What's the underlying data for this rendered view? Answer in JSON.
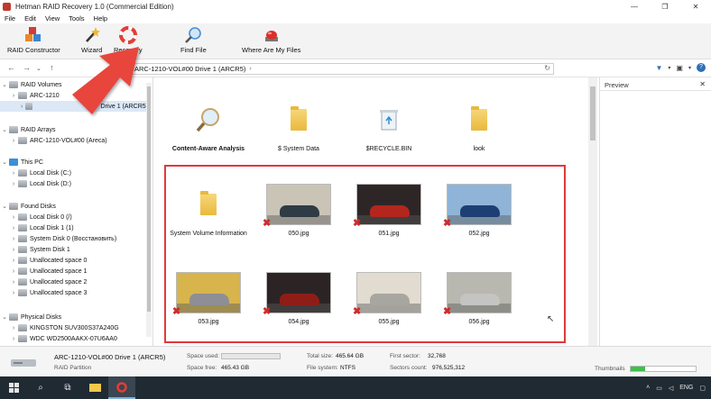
{
  "window": {
    "title": "Hetman RAID Recovery 1.0 (Commercial Edition)",
    "minimize": "—",
    "maximize": "❐",
    "close": "✕"
  },
  "menu": [
    "File",
    "Edit",
    "View",
    "Tools",
    "Help"
  ],
  "ribbon": {
    "raid_constructor": "RAID Constructor",
    "wizard": "Wizard",
    "recovery": "Recovery",
    "find_file": "Find File",
    "where_are_my_files": "Where Are My Files"
  },
  "address": {
    "path": "ARC-1210-VOL#00 Drive 1 (ARCR5)",
    "chevron": "›",
    "refresh": "↻"
  },
  "tree": {
    "raid_volumes": "RAID Volumes",
    "rv_item1": "ARC-1210",
    "rv_item2": "Drive 1 (ARCR5)",
    "raid_arrays": "RAID Arrays",
    "ra_item1": "ARC-1210-VOL#00 (Areca)",
    "this_pc": "This PC",
    "local_c": "Local Disk (C:)",
    "local_d": "Local Disk (D:)",
    "found_disks": "Found Disks",
    "fd_local0": "Local Disk 0 (/)",
    "fd_local1": "Local Disk 1 (1)",
    "fd_sys0": "System Disk 0 (Восстановить)",
    "fd_sys1": "System Disk 1",
    "fd_un0": "Unallocated space 0",
    "fd_un1": "Unallocated space 1",
    "fd_un2": "Unallocated space 2",
    "fd_un3": "Unallocated space 3",
    "physical_disks": "Physical Disks",
    "pd_kingston": "KINGSTON SUV300S37A240G",
    "pd_wdc": "WDC WD2500AAKX-07U6AA0"
  },
  "files": {
    "top": [
      {
        "name": "Content-Aware Analysis",
        "kind": "magnifier"
      },
      {
        "name": "$ System Data",
        "kind": "folder"
      },
      {
        "name": "$RECYCLE.BIN",
        "kind": "recycle"
      },
      {
        "name": "look",
        "kind": "folder"
      }
    ],
    "row1": [
      {
        "name": "System Volume Information",
        "kind": "folder"
      },
      {
        "name": "050.jpg",
        "kind": "photo",
        "sky": "#c9c4b6",
        "car": "#2f3b45"
      },
      {
        "name": "051.jpg",
        "kind": "photo",
        "sky": "#2e2626",
        "car": "#b3261e"
      },
      {
        "name": "052.jpg",
        "kind": "photo",
        "sky": "#8fb4d8",
        "car": "#1d3f73"
      }
    ],
    "row2": [
      {
        "name": "053.jpg",
        "kind": "photo",
        "sky": "#d8b44c",
        "car": "#8d8f94"
      },
      {
        "name": "054.jpg",
        "kind": "photo",
        "sky": "#2c2424",
        "car": "#8e1d18"
      },
      {
        "name": "055.jpg",
        "kind": "photo",
        "sky": "#e2dcd0",
        "car": "#a8a6a0"
      },
      {
        "name": "056.jpg",
        "kind": "photo",
        "sky": "#b8b8b0",
        "car": "#c4c4c2"
      }
    ]
  },
  "preview": {
    "title": "Preview",
    "close": "✕"
  },
  "status": {
    "name": "ARC-1210-VOL#00 Drive 1 (ARCR5)",
    "type": "RAID Partition",
    "space_used_label": "Space used:",
    "space_free_label": "Space free:",
    "space_free": "465.43 GB",
    "total_size_label": "Total size:",
    "total_size": "465.64 GB",
    "file_system_label": "File system:",
    "file_system": "NTFS",
    "first_sector_label": "First sector:",
    "first_sector": "32,768",
    "sectors_count_label": "Sectors count:",
    "sectors_count": "976,525,312",
    "thumbnails_label": "Thumbnails",
    "thumbnails_level": 0.22
  },
  "taskbar": {
    "lang": "ENG",
    "icons": [
      "windows-icon",
      "search-icon",
      "task-view-icon",
      "file-explorer-icon",
      "raid-recovery-icon"
    ]
  },
  "colors": {
    "highlight_box": "#e0393b",
    "arrow": "#e8453c",
    "selection": "#dce8f6",
    "thumbnail_fill": "#3fbf4a"
  }
}
